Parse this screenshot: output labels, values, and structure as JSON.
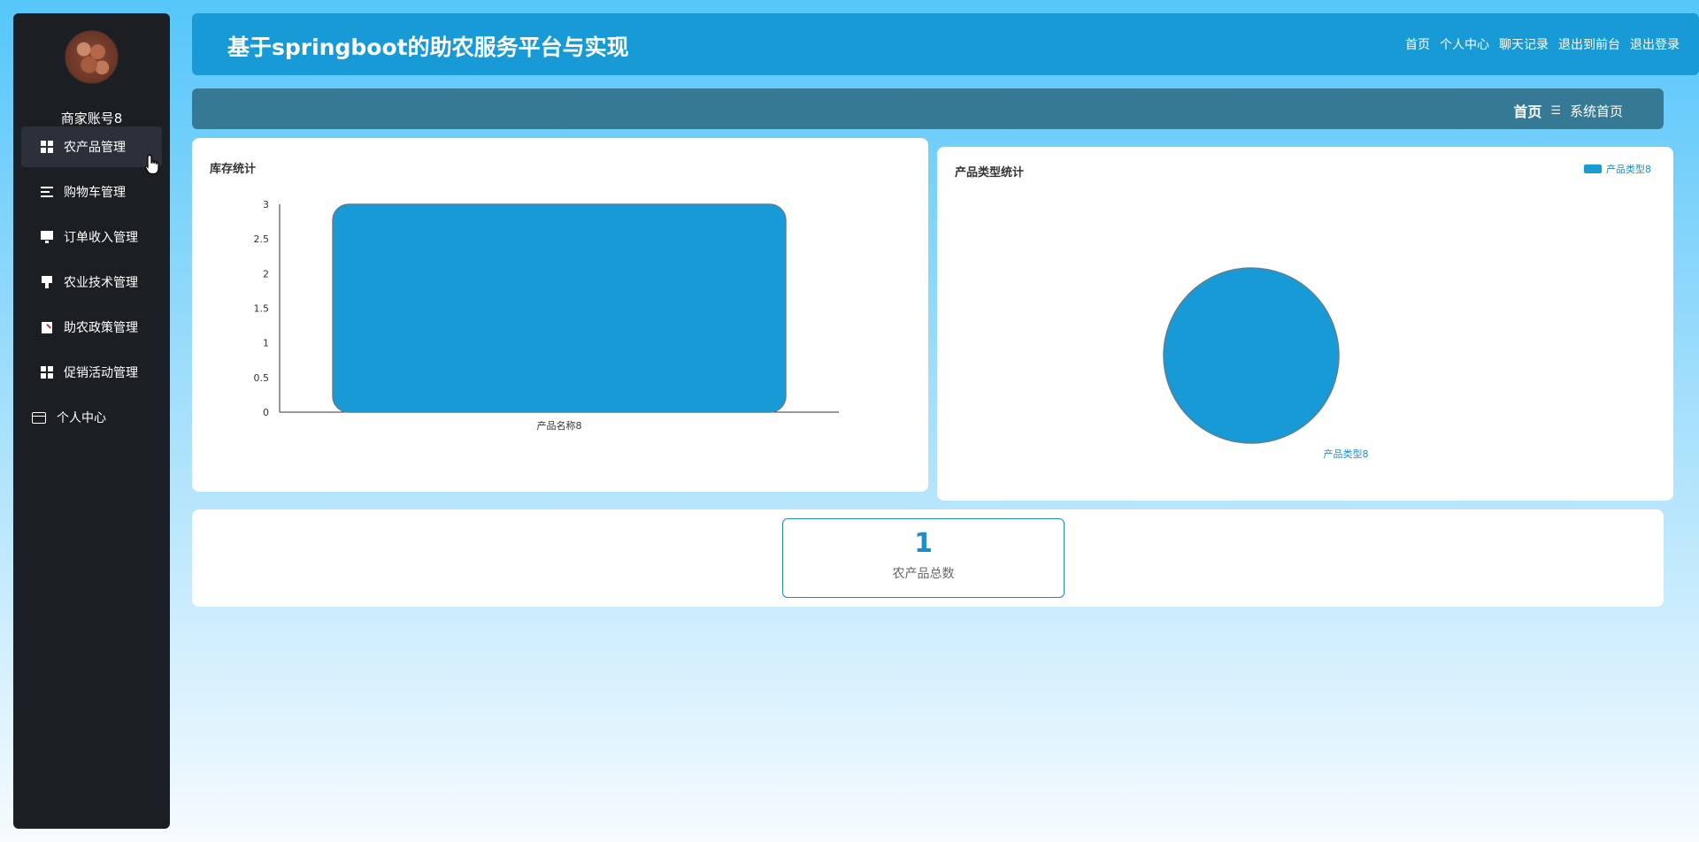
{
  "sidebar": {
    "username": "商家账号8",
    "items": [
      {
        "label": "农产品管理",
        "icon": "grid-icon"
      },
      {
        "label": "购物车管理",
        "icon": "list-icon"
      },
      {
        "label": "订单收入管理",
        "icon": "monitor-icon"
      },
      {
        "label": "农业技术管理",
        "icon": "brush-icon"
      },
      {
        "label": "助农政策管理",
        "icon": "clipboard-icon"
      },
      {
        "label": "促销活动管理",
        "icon": "grid-icon"
      },
      {
        "label": "个人中心",
        "icon": "card-icon"
      }
    ]
  },
  "header": {
    "title": "基于springboot的助农服务平台与实现",
    "nav": [
      "首页",
      "个人中心",
      "聊天记录",
      "退出到前台",
      "退出登录"
    ]
  },
  "breadcrumb": {
    "home": "首页",
    "separator": "☰",
    "current": "系统首页"
  },
  "colors": {
    "accent": "#189ad6",
    "sidebar": "#1b1f23",
    "crumb_bar": "#357995"
  },
  "chart_data": [
    {
      "type": "bar",
      "title": "库存统计",
      "categories": [
        "产品名称8"
      ],
      "values": [
        3
      ],
      "ylim": [
        0,
        3
      ],
      "yticks": [
        "0",
        "0.5",
        "1",
        "1.5",
        "2",
        "2.5",
        "3"
      ],
      "color": "#189ad6"
    },
    {
      "type": "pie",
      "title": "产品类型统计",
      "labels": [
        "产品类型8"
      ],
      "values": [
        1
      ],
      "legend": "top-right",
      "color": "#189ad6"
    }
  ],
  "stats": {
    "value": "1",
    "label": "农产品总数"
  }
}
